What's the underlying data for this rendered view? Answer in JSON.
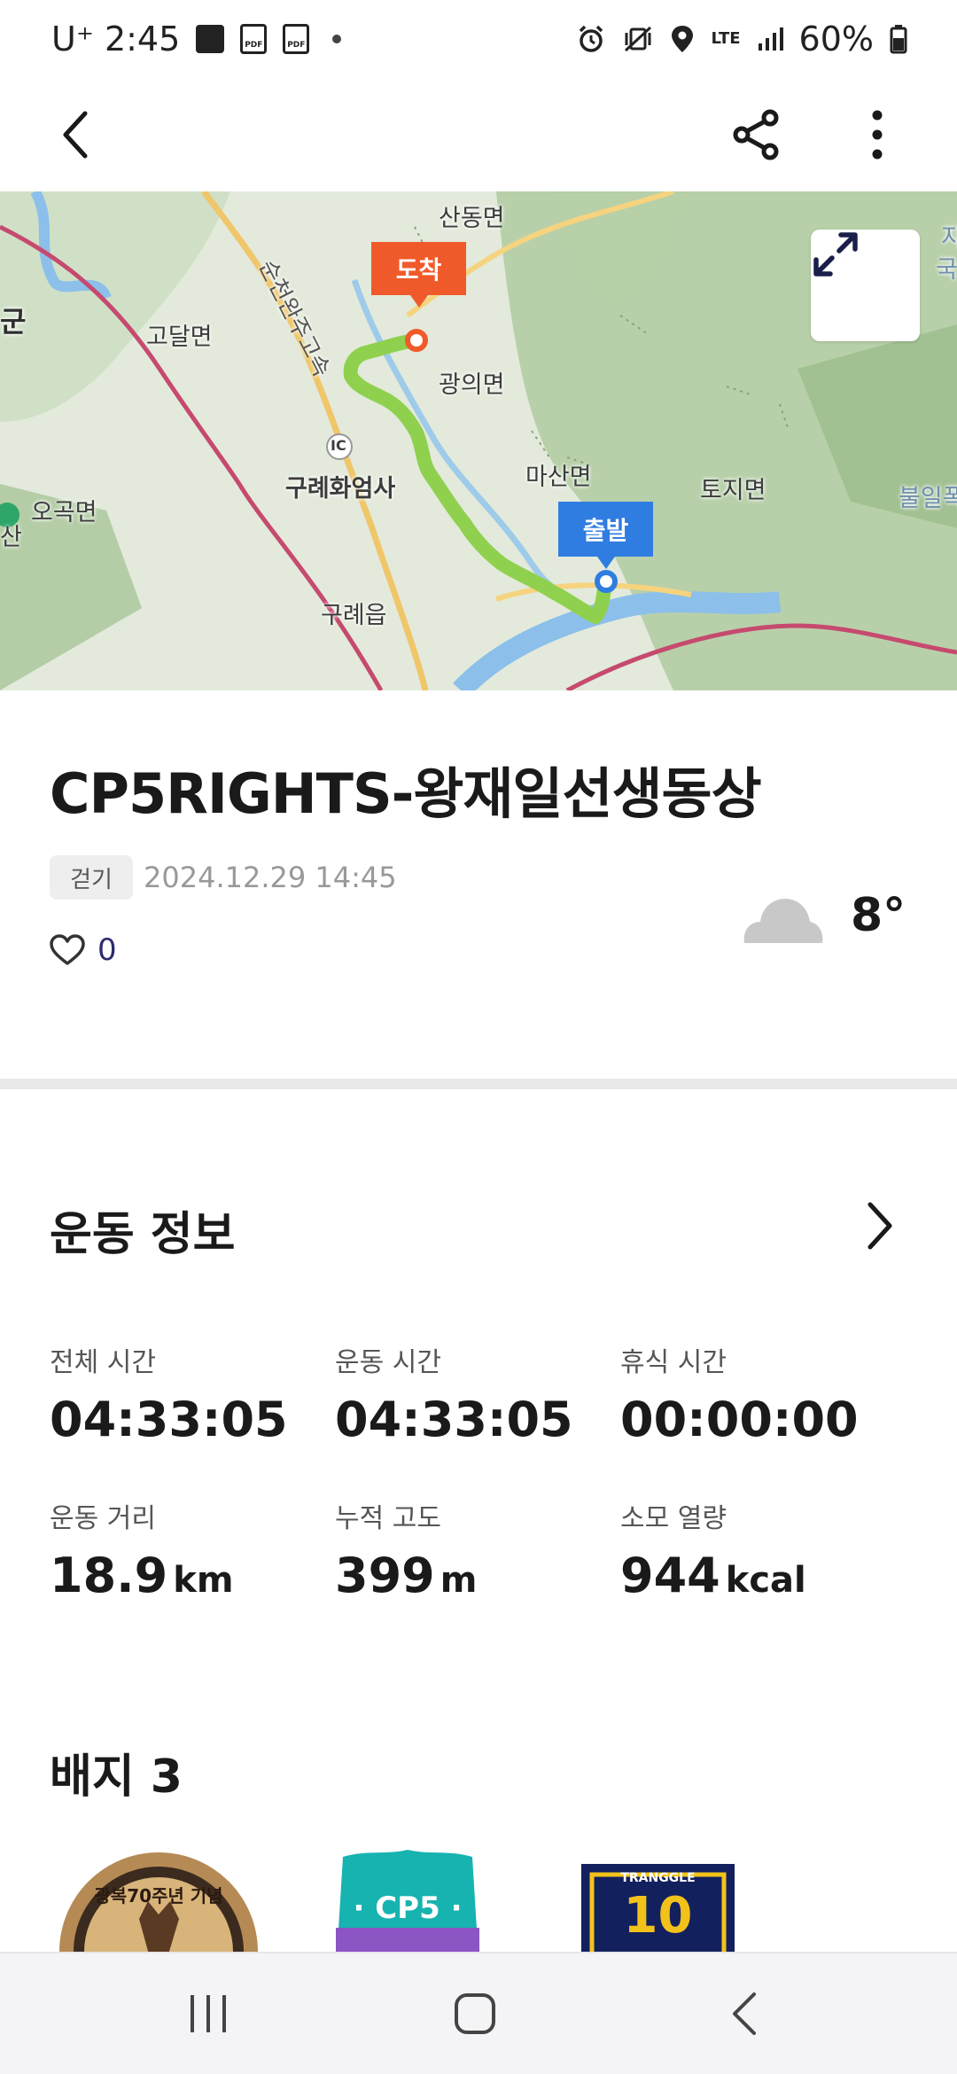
{
  "status_bar": {
    "carrier_time": "U⁺ 2:45",
    "network": "LTE",
    "battery": "60%",
    "icons": [
      "gallery-icon",
      "pdf-icon",
      "pdf-icon",
      "dot-icon",
      "alarm-icon",
      "vibrate-icon",
      "location-icon",
      "lte-icon",
      "signal-icon",
      "battery-icon"
    ]
  },
  "app_bar": {
    "icons": [
      "back-icon",
      "share-icon",
      "more-vert-icon"
    ]
  },
  "map": {
    "labels": {
      "sandong": "산동면",
      "gun": "군",
      "godal": "고달면",
      "expressway": "순천완주고속",
      "gwangui": "광의면",
      "ic": "IC",
      "hwaeomsa": "구례화엄사",
      "masan": "마산면",
      "toji": "토지면",
      "bulil": "불일폭",
      "ogok": "오곡면",
      "san": "산",
      "gurye": "구례읍",
      "ji": "지",
      "guk": "국"
    },
    "end_pin": "도착",
    "start_pin": "출발",
    "route_color": "#8fd14f"
  },
  "activity": {
    "title": "CP5RIGHTS-왕재일선생동상",
    "type_tag": "걷기",
    "datetime": "2024.12.29 14:45",
    "like_count": "0",
    "weather_icon": "cloud-icon",
    "temperature": "8°"
  },
  "workout": {
    "section_title": "운동 정보",
    "stats": [
      {
        "label": "전체 시간",
        "value": "04:33:05",
        "unit": ""
      },
      {
        "label": "운동 시간",
        "value": "04:33:05",
        "unit": ""
      },
      {
        "label": "휴식 시간",
        "value": "00:00:00",
        "unit": ""
      },
      {
        "label": "운동 거리",
        "value": "18.9",
        "unit": "km"
      },
      {
        "label": "누적 고도",
        "value": "399",
        "unit": "m"
      },
      {
        "label": "소모 열량",
        "value": "944",
        "unit": "kcal"
      }
    ]
  },
  "badges": {
    "section_title": "배지 3",
    "items": [
      {
        "name": "anniversary-seal-badge",
        "text": "광복70주년 기념"
      },
      {
        "name": "cp5-badge",
        "text": "· CP5 ·"
      },
      {
        "name": "tranggle-10-badge",
        "text_top": "TRANGGLE",
        "text_main": "10"
      }
    ]
  },
  "nav_bar": {
    "icons": [
      "recent-apps-icon",
      "home-icon",
      "back-nav-icon"
    ]
  }
}
